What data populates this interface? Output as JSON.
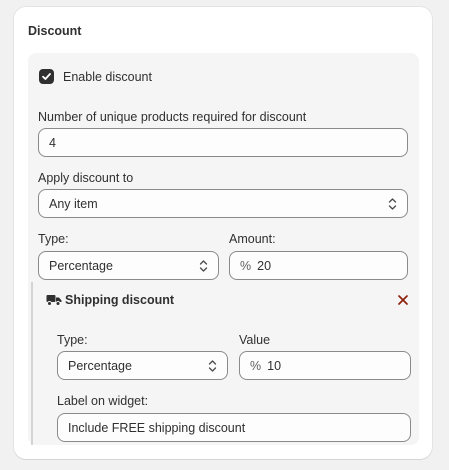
{
  "card": {
    "title": "Discount"
  },
  "enable_discount": {
    "label": "Enable discount",
    "checked": true
  },
  "unique_products": {
    "label": "Number of unique products required for discount",
    "value": "4"
  },
  "apply_to": {
    "label": "Apply discount to",
    "value": "Any item"
  },
  "type": {
    "label": "Type:",
    "value": "Percentage"
  },
  "amount": {
    "label": "Amount:",
    "prefix": "%",
    "value": "20"
  },
  "shipping": {
    "title": "Shipping discount",
    "icon": "truck-icon",
    "close_icon": "close-icon",
    "close_color": "#8e1f0b",
    "type": {
      "label": "Type:",
      "value": "Percentage"
    },
    "value": {
      "label": "Value",
      "prefix": "%",
      "value": "10"
    },
    "widget_label": {
      "label": "Label on widget:",
      "value": "Include FREE shipping discount"
    }
  }
}
